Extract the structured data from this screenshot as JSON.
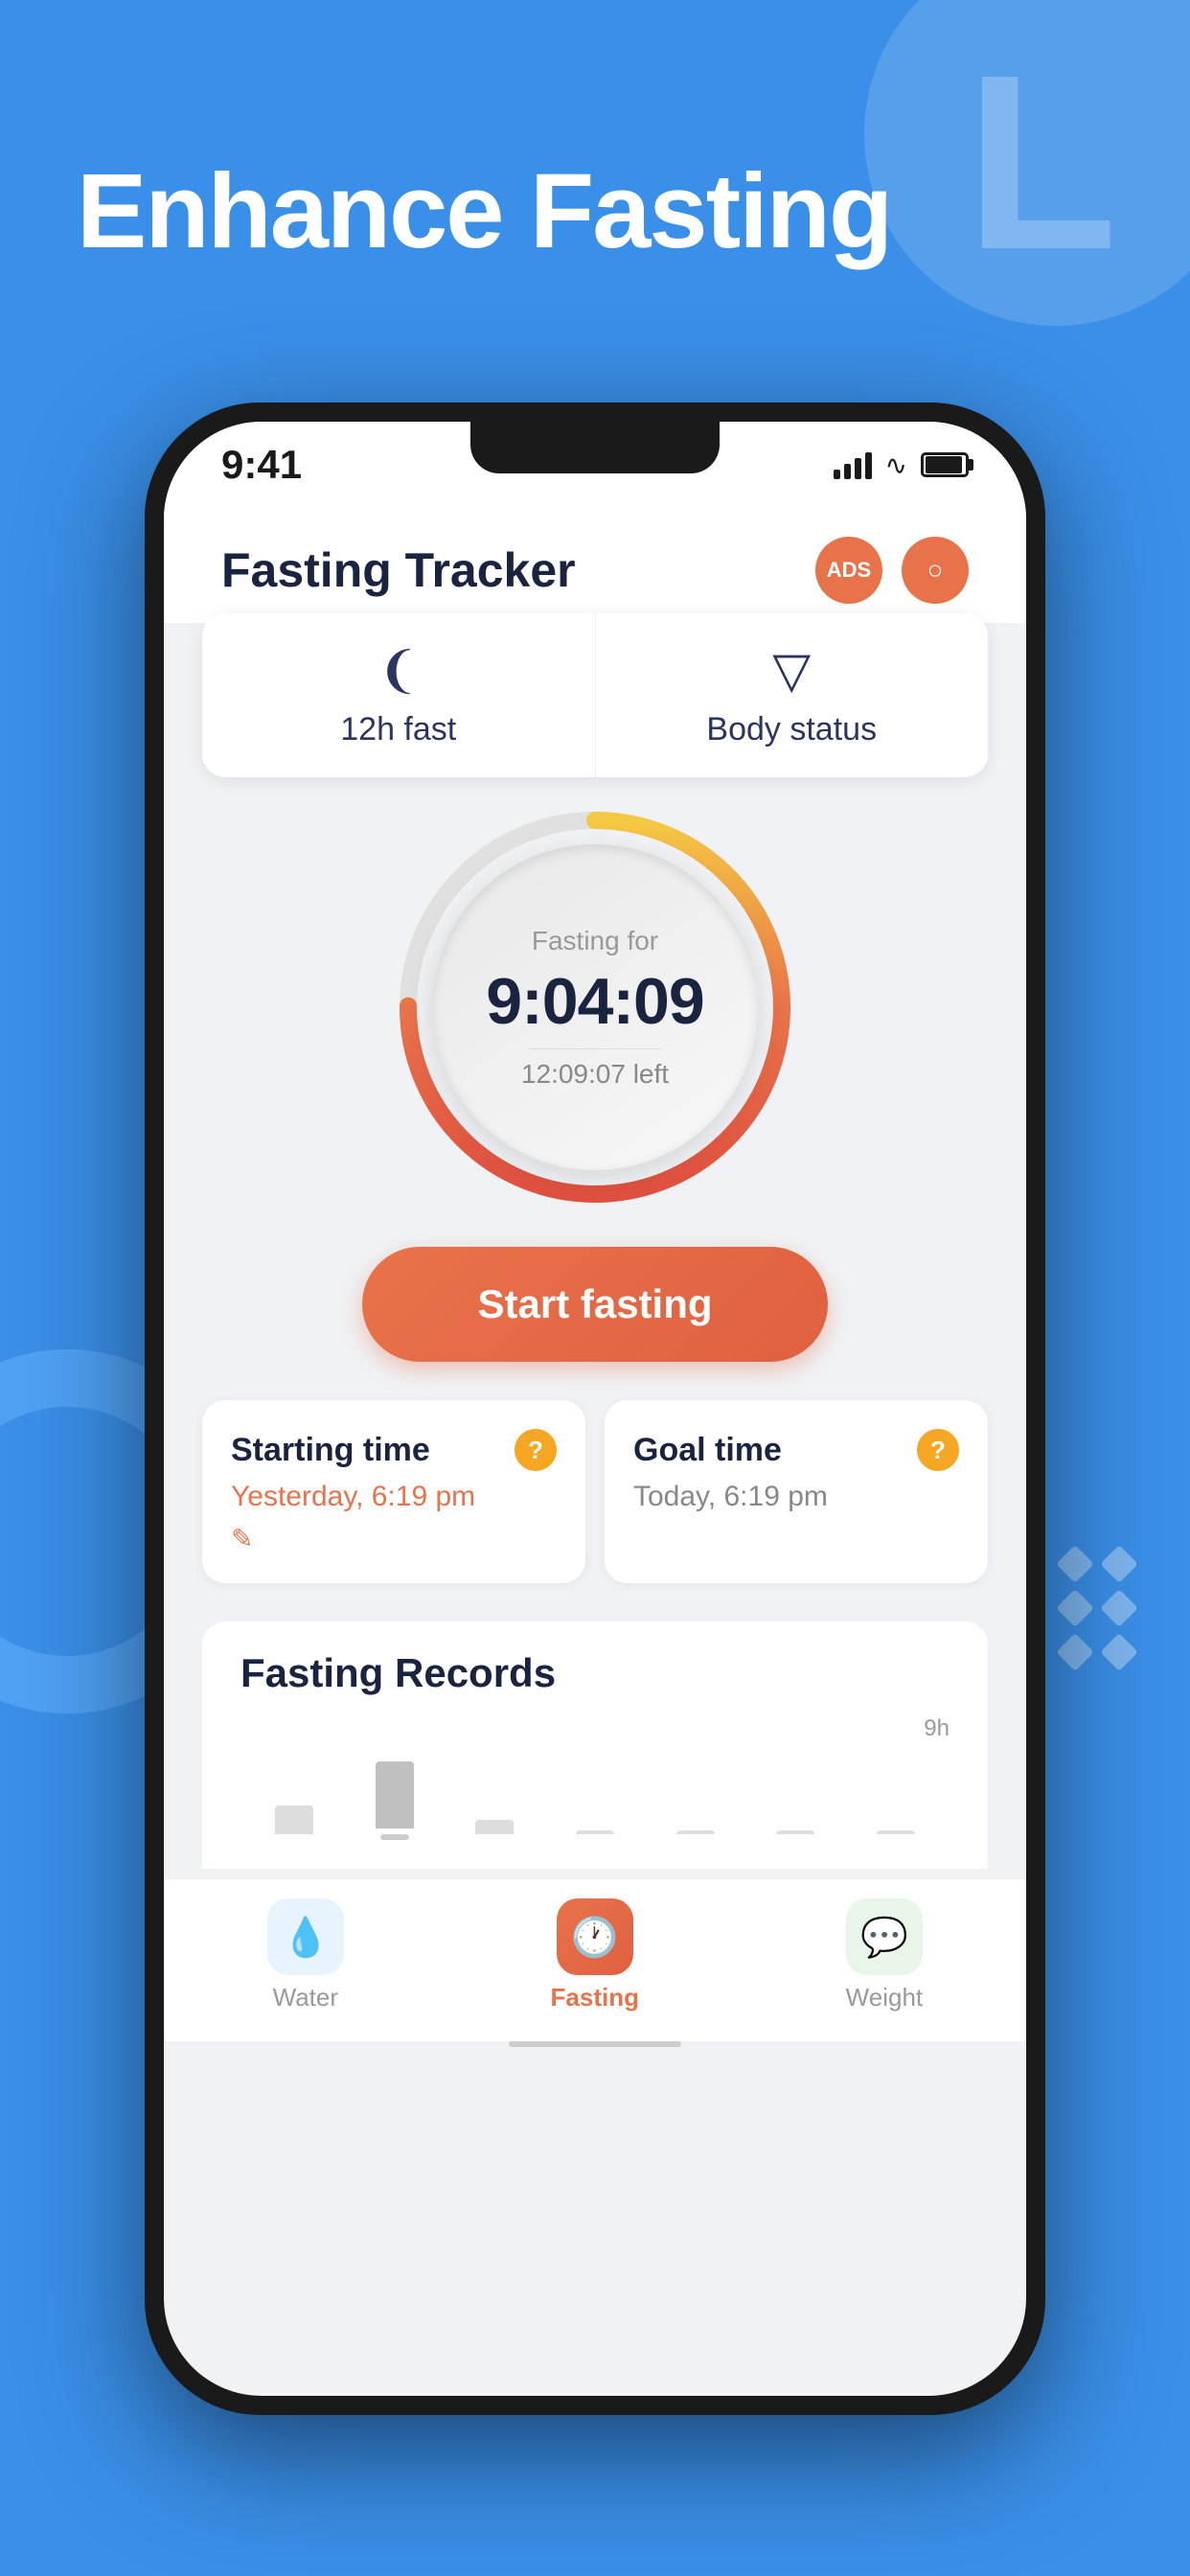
{
  "page": {
    "title": "Enhance Fasting",
    "background_color": "#3a8fe8"
  },
  "phone": {
    "status_bar": {
      "time": "9:41"
    },
    "app_header": {
      "title": "Fasting Tracker",
      "btn_ads_label": "ADS",
      "btn_settings_label": "⚙"
    },
    "mode_tabs": [
      {
        "icon": "fast-icon",
        "label": "12h fast"
      },
      {
        "icon": "leaf-icon",
        "label": "Body status"
      }
    ],
    "timer": {
      "label": "Fasting for",
      "time": "9:04:09",
      "time_left": "12:09:07 left"
    },
    "start_button": {
      "label": "Start fasting"
    },
    "info_cards": [
      {
        "title": "Starting time",
        "value": "Yesterday, 6:19 pm",
        "has_edit": true,
        "value_color": "orange"
      },
      {
        "title": "Goal time",
        "value": "Today, 6:19 pm",
        "has_edit": false,
        "value_color": "gray"
      }
    ],
    "records": {
      "title": "Fasting Records",
      "chart_label": "9h",
      "bars": [
        {
          "label": "",
          "height": 30,
          "active": false
        },
        {
          "label": "",
          "height": 70,
          "active": true
        },
        {
          "label": "",
          "height": 15,
          "active": false
        },
        {
          "label": "",
          "height": 0,
          "active": false
        },
        {
          "label": "",
          "height": 0,
          "active": false
        },
        {
          "label": "",
          "height": 0,
          "active": false
        },
        {
          "label": "",
          "height": 0,
          "active": false
        }
      ]
    },
    "bottom_nav": [
      {
        "icon": "💧",
        "label": "Water",
        "active": false,
        "style": "water"
      },
      {
        "icon": "🕐",
        "label": "Fasting",
        "active": true,
        "style": "fasting"
      },
      {
        "icon": "💬",
        "label": "Weight",
        "active": false,
        "style": "weight"
      }
    ]
  }
}
